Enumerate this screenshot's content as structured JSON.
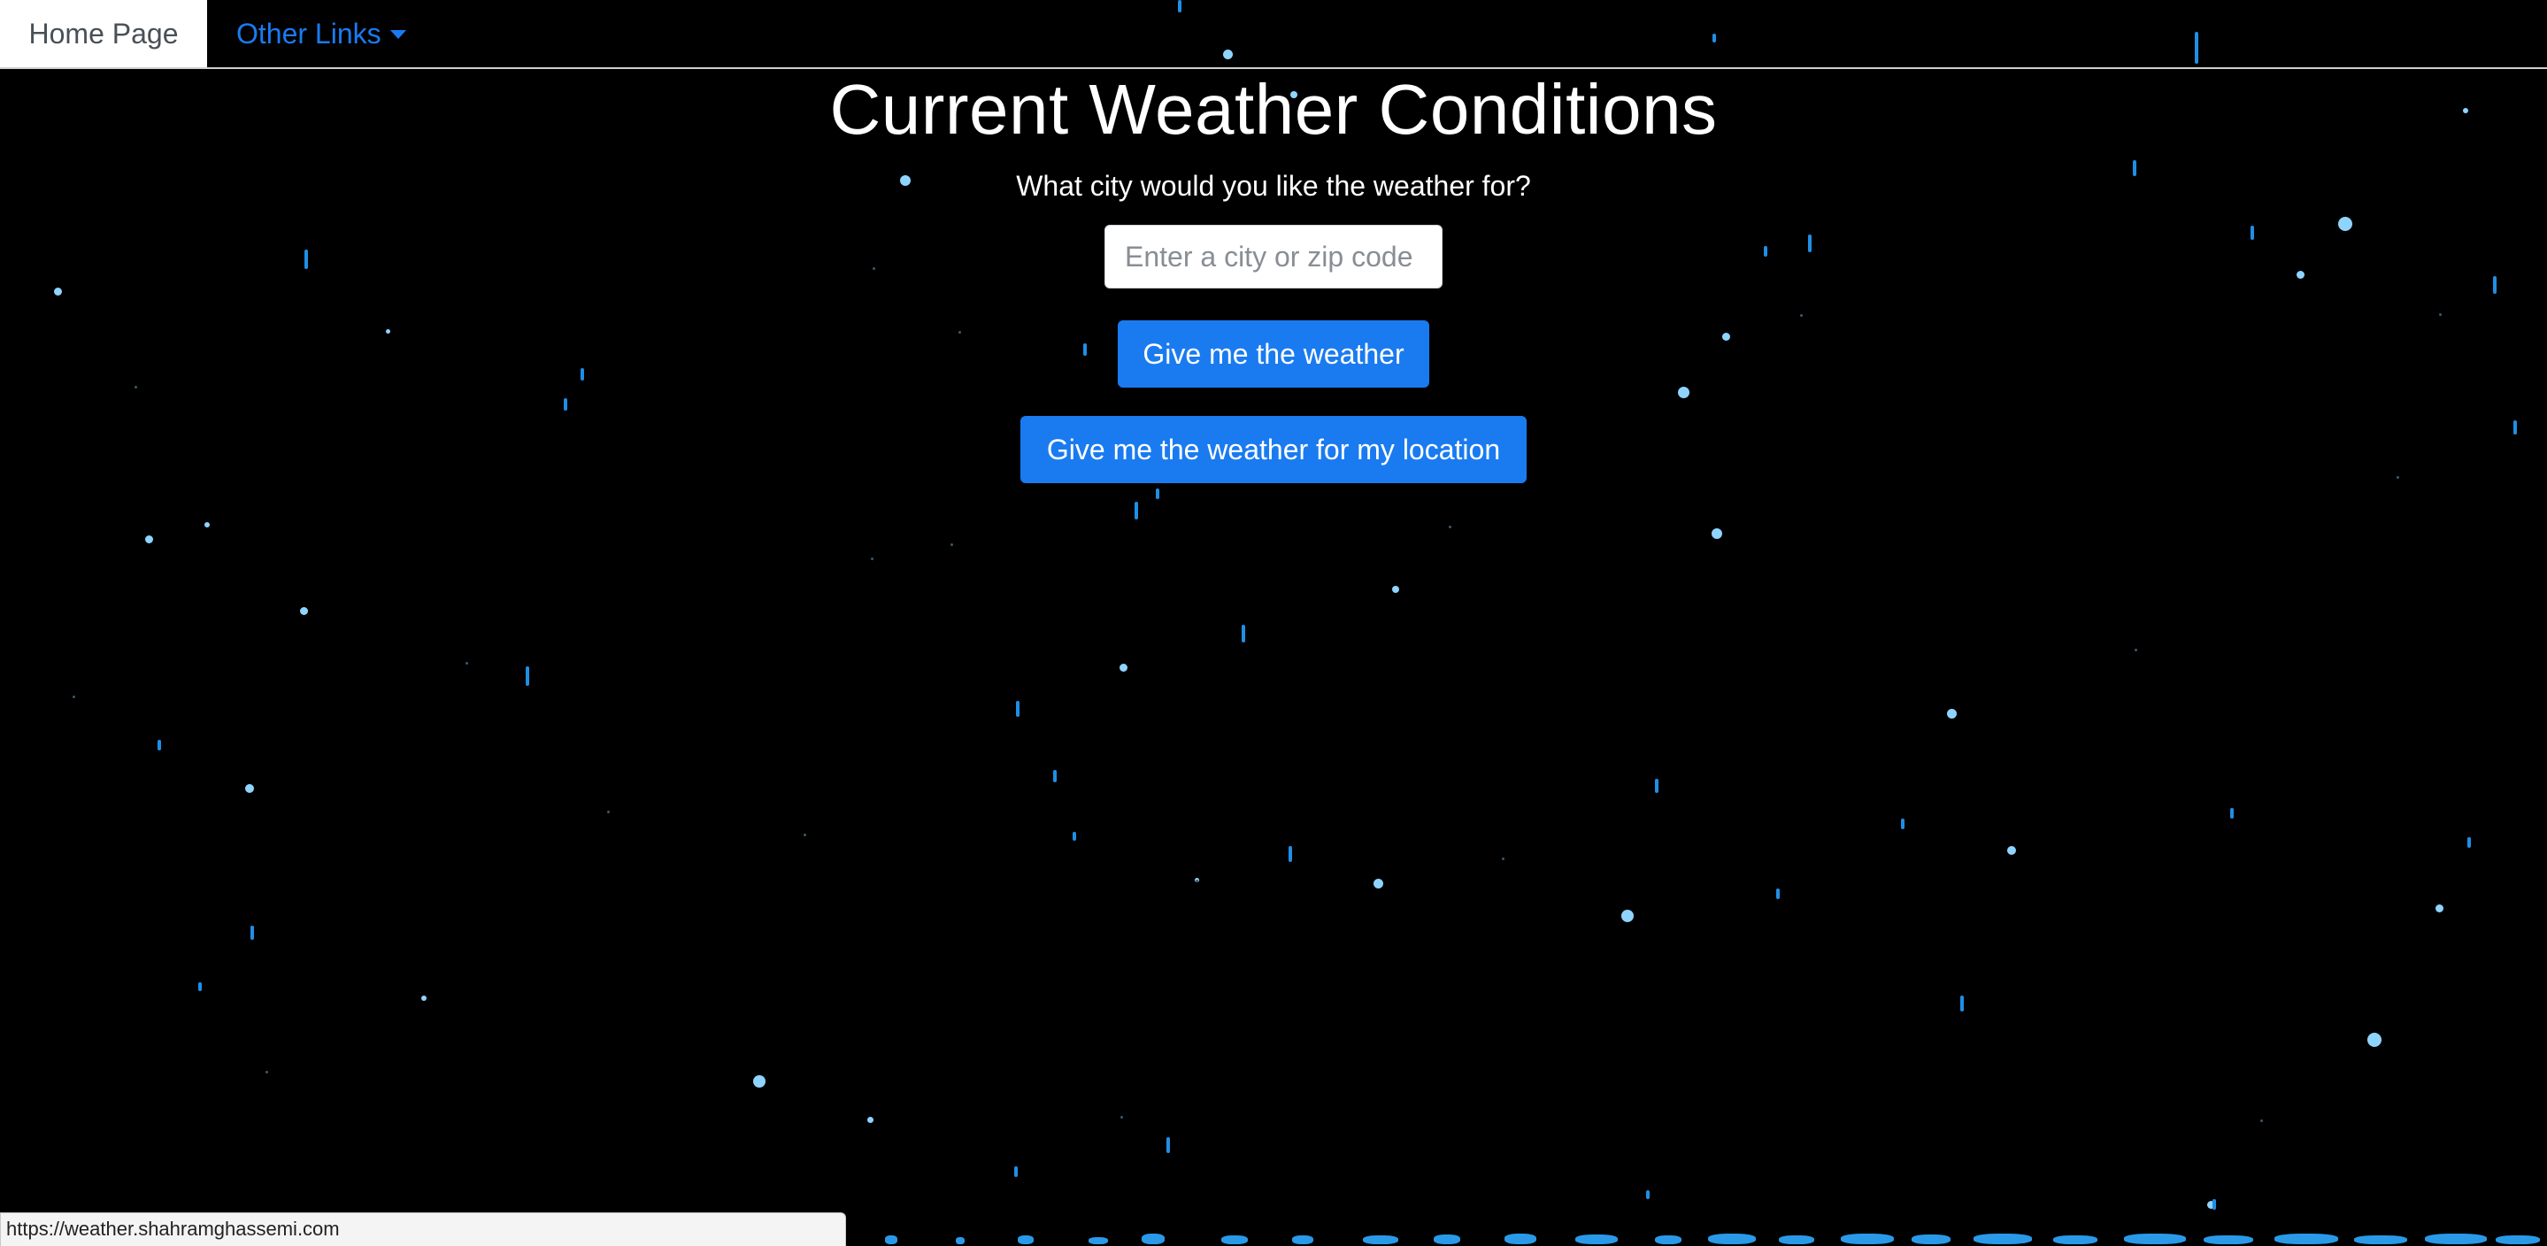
{
  "nav": {
    "home_label": "Home Page",
    "other_links_label": "Other Links"
  },
  "main": {
    "title": "Current Weather Conditions",
    "question": "What city would you like the weather for?",
    "city_input": {
      "placeholder": "Enter a city or zip code",
      "value": ""
    },
    "weather_button_label": "Give me the weather",
    "location_button_label": "Give me the weather for my location"
  },
  "status_bar": {
    "url": "https://weather.shahramghassemi.com"
  },
  "colors": {
    "background": "#000000",
    "accent": "#1a7bf0",
    "rain_drop": "#8fd4ff",
    "rain_streak": "#1f8fe6"
  }
}
